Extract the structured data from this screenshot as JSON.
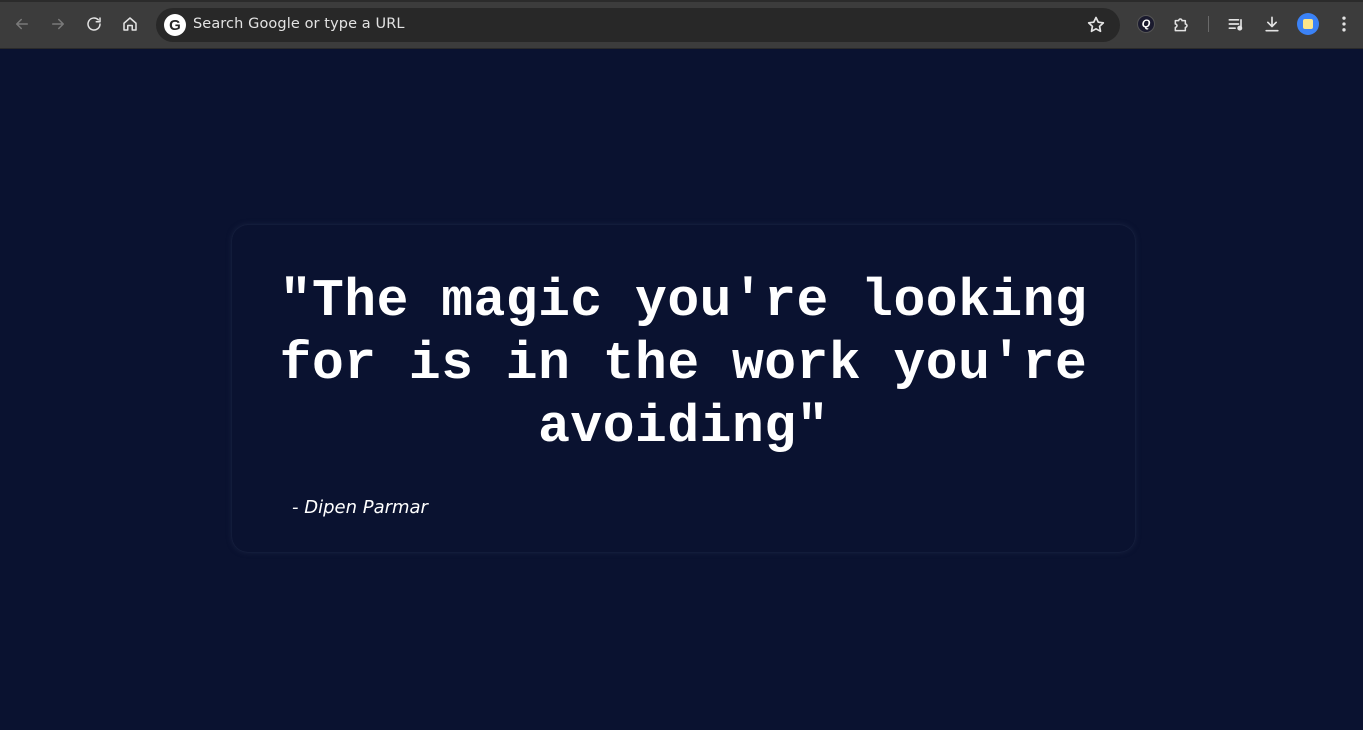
{
  "browser": {
    "omnibox": {
      "placeholder": "Search Google or type a URL"
    },
    "google_logo_letter": "G",
    "icons": {
      "back": "back-arrow-icon",
      "forward": "forward-arrow-icon",
      "reload": "reload-icon",
      "home": "home-icon",
      "bookmark": "star-icon",
      "extension_q": "q-extension-icon",
      "extensions": "puzzle-icon",
      "reading_list": "reading-list-icon",
      "downloads": "download-icon",
      "profile": "avatar",
      "menu": "kebab-menu-icon"
    },
    "extension_q_letter": "Q"
  },
  "quote_card": {
    "quote": "\"The magic you're looking for is in the work you're avoiding\"",
    "author": "- Dipen Parmar"
  },
  "colors": {
    "page_background": "#0a1230",
    "toolbar": "#3c3c3c",
    "omnibox": "#282828",
    "text": "#ffffff"
  }
}
